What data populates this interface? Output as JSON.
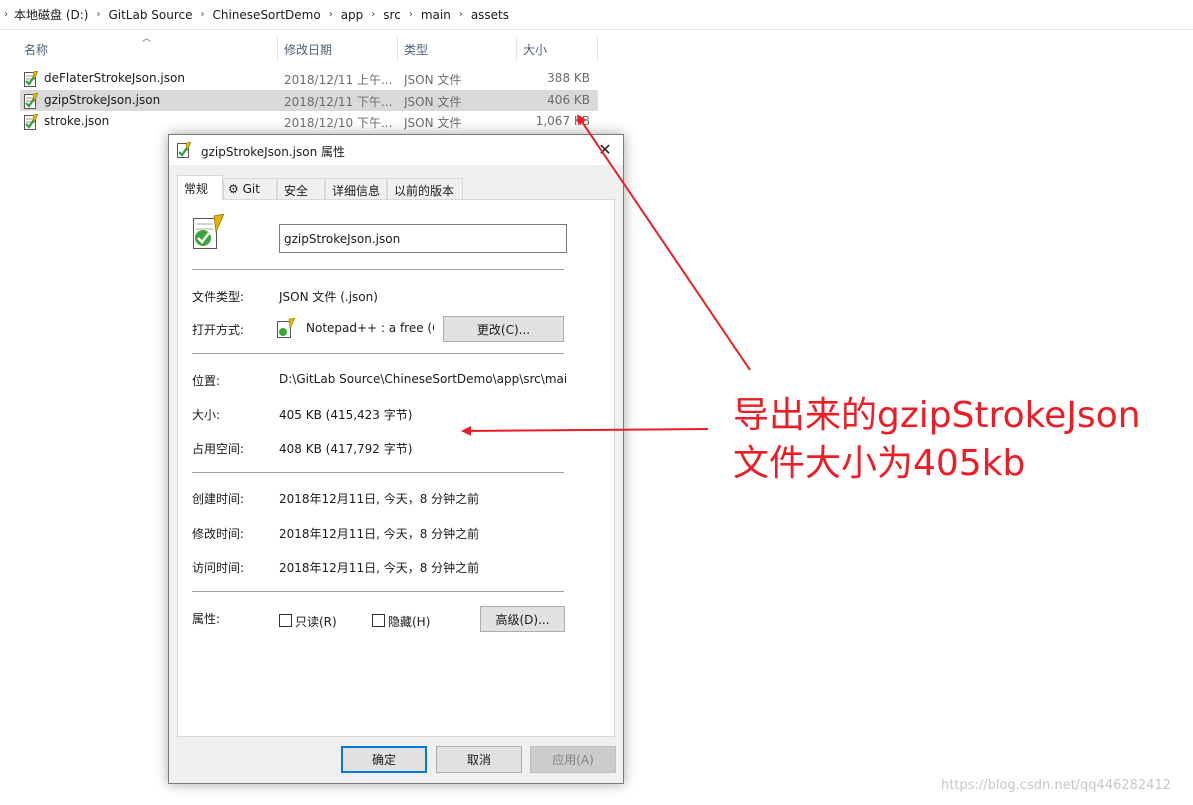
{
  "breadcrumb": [
    "本地磁盘 (D:)",
    "GitLab Source",
    "ChineseSortDemo",
    "app",
    "src",
    "main",
    "assets"
  ],
  "columns": {
    "name": "名称",
    "date": "修改日期",
    "type": "类型",
    "size": "大小"
  },
  "files": [
    {
      "name": "deFlaterStrokeJson.json",
      "date": "2018/12/11 上午...",
      "type": "JSON 文件",
      "size": "388 KB",
      "selected": false
    },
    {
      "name": "gzipStrokeJson.json",
      "date": "2018/12/11 下午...",
      "type": "JSON 文件",
      "size": "406 KB",
      "selected": true
    },
    {
      "name": "stroke.json",
      "date": "2018/12/10 下午...",
      "type": "JSON 文件",
      "size": "1,067 KB",
      "selected": false
    }
  ],
  "dialog": {
    "title": "gzipStrokeJson.json 属性",
    "tabs": [
      "常规",
      "Git",
      "安全",
      "详细信息",
      "以前的版本"
    ],
    "file_name": "gzipStrokeJson.json",
    "props": {
      "type_label": "文件类型:",
      "type_value": "JSON 文件 (.json)",
      "open_label": "打开方式:",
      "open_value": "Notepad++ : a free (G",
      "change_button": "更改(C)...",
      "location_label": "位置:",
      "location_value": "D:\\GitLab Source\\ChineseSortDemo\\app\\src\\main",
      "size_label": "大小:",
      "size_value": "405 KB (415,423 字节)",
      "disk_label": "占用空间:",
      "disk_value": "408 KB (417,792 字节)",
      "created_label": "创建时间:",
      "created_value": "2018年12月11日, 今天，8 分钟之前",
      "modified_label": "修改时间:",
      "modified_value": "2018年12月11日, 今天，8 分钟之前",
      "accessed_label": "访问时间:",
      "accessed_value": "2018年12月11日, 今天，8 分钟之前",
      "attr_label": "属性:",
      "readonly": "只读(R)",
      "hidden": "隐藏(H)",
      "advanced_button": "高级(D)..."
    },
    "buttons": {
      "ok": "确定",
      "cancel": "取消",
      "apply": "应用(A)"
    }
  },
  "annotation": {
    "line1": "导出来的gzipStrokeJson",
    "line2": "文件大小为405kb"
  },
  "watermark": "https://blog.csdn.net/qq446282412",
  "colors": {
    "annotation": "#ee1c24",
    "selected_row": "#d9d9d9",
    "default_button_border": "#0078d7"
  }
}
